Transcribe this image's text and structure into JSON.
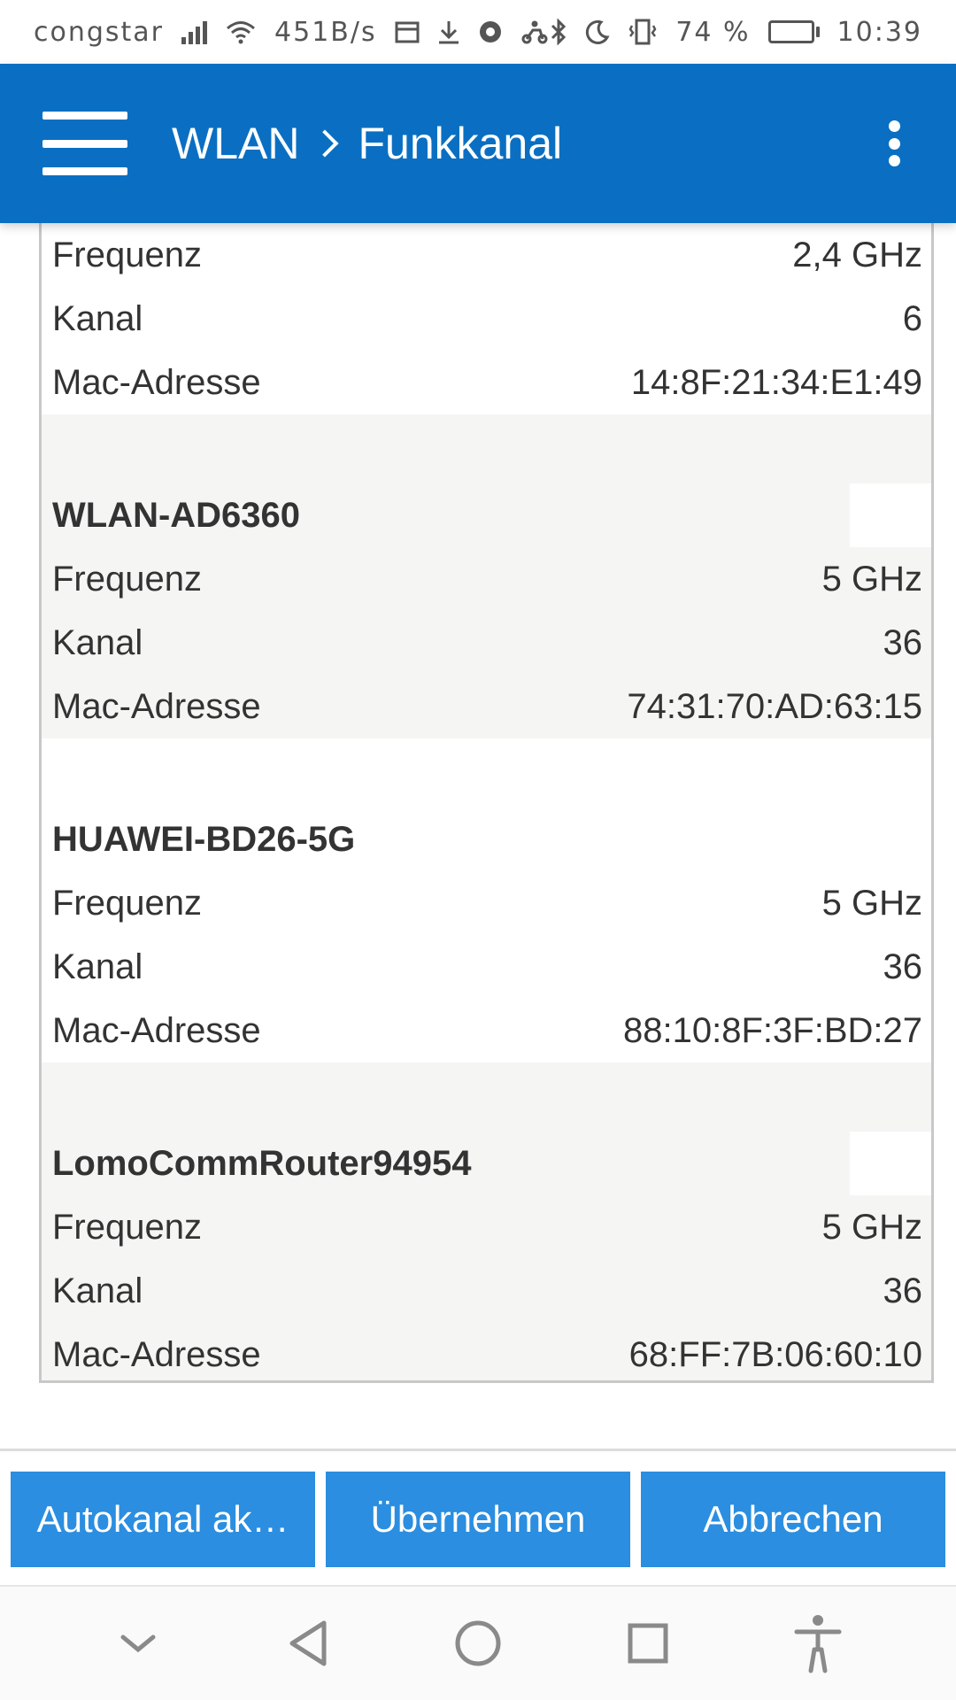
{
  "status_bar": {
    "carrier": "congstar",
    "speed": "451B/s",
    "battery_percent": "74 %",
    "battery_level": 0.74,
    "time": "10:39",
    "icons": [
      "signal-icon",
      "wifi-icon",
      "calendar-icon",
      "download-icon",
      "chrome-icon",
      "delivery-icon",
      "bluetooth-icon",
      "moon-icon",
      "vibrate-icon",
      "battery-icon"
    ]
  },
  "app_bar": {
    "section": "WLAN",
    "page": "Funkkanal",
    "menu_icon": "hamburger-menu-icon",
    "overflow_icon": "more-vert-icon",
    "color": "#0a6fc2"
  },
  "first_network": {
    "rows": [
      {
        "label": "Frequenz",
        "value": "2,4 GHz"
      },
      {
        "label": "Kanal",
        "value": "6"
      },
      {
        "label": "Mac-Adresse",
        "value": "14:8F:21:34:E1:49"
      }
    ]
  },
  "networks": [
    {
      "name": "WLAN-AD6360",
      "rows": [
        {
          "label": "Frequenz",
          "value": "5 GHz"
        },
        {
          "label": "Kanal",
          "value": "36"
        },
        {
          "label": "Mac-Adresse",
          "value": "74:31:70:AD:63:15"
        }
      ]
    },
    {
      "name": "HUAWEI-BD26-5G",
      "rows": [
        {
          "label": "Frequenz",
          "value": "5 GHz"
        },
        {
          "label": "Kanal",
          "value": "36"
        },
        {
          "label": "Mac-Adresse",
          "value": "88:10:8F:3F:BD:27"
        }
      ]
    },
    {
      "name": "LomoCommRouter94954",
      "rows": [
        {
          "label": "Frequenz",
          "value": "5 GHz"
        },
        {
          "label": "Kanal",
          "value": "36"
        },
        {
          "label": "Mac-Adresse",
          "value": "68:FF:7B:06:60:10"
        }
      ]
    }
  ],
  "actions": {
    "autokanal_label": "Autokanal ak…",
    "apply_label": "Übernehmen",
    "cancel_label": "Abbrechen",
    "color": "#2b8ee0"
  },
  "nav_bar": {
    "icons": [
      "chevron-down-icon",
      "back-icon",
      "home-icon",
      "recents-icon",
      "accessibility-icon"
    ]
  }
}
